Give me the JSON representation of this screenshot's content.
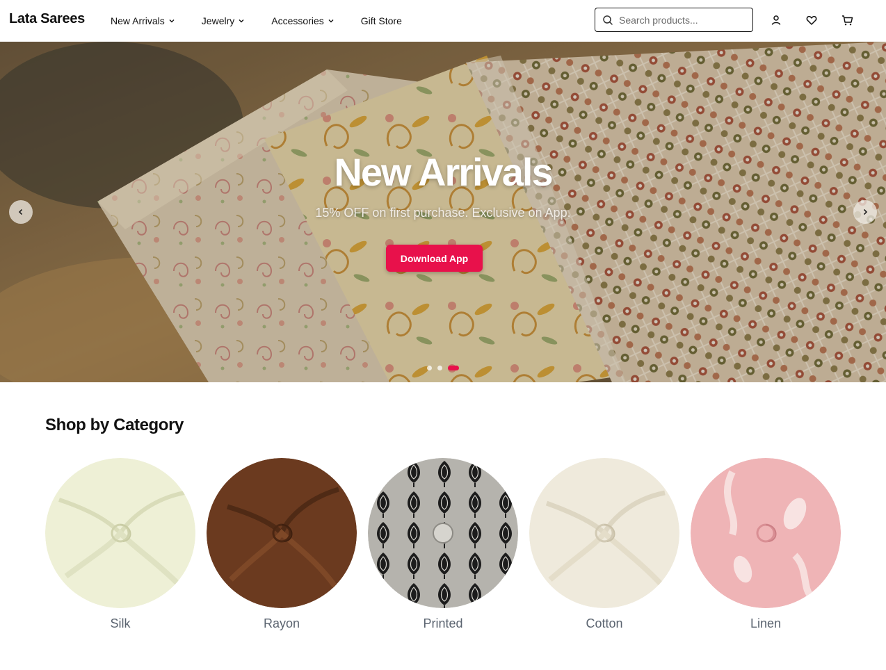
{
  "header": {
    "brand": "Lata Sarees",
    "nav": [
      {
        "label": "New Arrivals",
        "has_dropdown": true
      },
      {
        "label": "Jewelry",
        "has_dropdown": true
      },
      {
        "label": "Accessories",
        "has_dropdown": true
      },
      {
        "label": "Gift Store",
        "has_dropdown": false
      }
    ],
    "search": {
      "placeholder": "Search products...",
      "value": ""
    },
    "icons": [
      "user-icon",
      "heart-icon",
      "cart-icon"
    ]
  },
  "hero": {
    "title": "New Arrivals",
    "subtitle": "15% OFF on first purchase. Exclusive on App.",
    "button_label": "Download App",
    "slide_count": 3,
    "active_slide": 3,
    "accent_color": "#e8114b"
  },
  "categories": {
    "title": "Shop by Category",
    "items": [
      {
        "label": "Silk",
        "color": "#eef0d6"
      },
      {
        "label": "Rayon",
        "color": "#6b3a1f"
      },
      {
        "label": "Printed",
        "color": "#b5b3ad"
      },
      {
        "label": "Cotton",
        "color": "#efeadc"
      },
      {
        "label": "Linen",
        "color": "#efb4b6"
      }
    ]
  }
}
